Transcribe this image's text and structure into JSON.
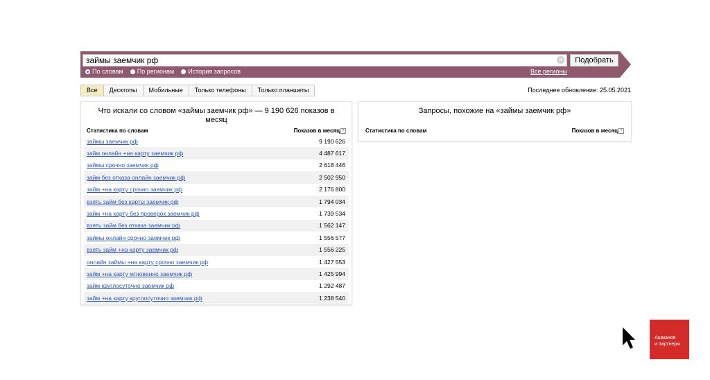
{
  "search": {
    "query": "займы заемчик рф",
    "submit_label": "Подобрать",
    "clear_icon": "clear-icon",
    "modes": [
      {
        "label": "По словам",
        "selected": true
      },
      {
        "label": "По регионам",
        "selected": false
      },
      {
        "label": "История запросов",
        "selected": false
      }
    ],
    "regions_link": "Все регионы"
  },
  "device_tabs": [
    {
      "label": "Все",
      "active": true
    },
    {
      "label": "Десктопы",
      "active": false
    },
    {
      "label": "Мобильные",
      "active": false
    },
    {
      "label": "Только телефоны",
      "active": false
    },
    {
      "label": "Только планшеты",
      "active": false
    }
  ],
  "last_update": "Последнее обновление: 25.05.2021",
  "left_panel": {
    "title": "Что искали со словом «займы заемчик рф» — 9 190 626 показов в месяц",
    "col_query": "Статистика по словам",
    "col_count": "Показов в месяц",
    "rows": [
      {
        "query": "займы заемчик рф",
        "count": "9 190 626"
      },
      {
        "query": "займ онлайн +на карту заемчик рф",
        "count": "4 487 617"
      },
      {
        "query": "займы срочно заемчик рф",
        "count": "2 618 446"
      },
      {
        "query": "займ без отказа онлайн заемчик рф",
        "count": "2 502 950"
      },
      {
        "query": "займ +на карту срочно заемчик рф",
        "count": "2 176 800"
      },
      {
        "query": "взять займ без карты заемчик рф",
        "count": "1 794 034"
      },
      {
        "query": "займ +на карту без проверок заемчик рф",
        "count": "1 739 534"
      },
      {
        "query": "взять займ без отказа заемчик рф",
        "count": "1 562 147"
      },
      {
        "query": "займы онлайн срочно заемчик рф",
        "count": "1 556 577"
      },
      {
        "query": "взять займ +на карту заемчик рф",
        "count": "1 556 225"
      },
      {
        "query": "онлайн займы +на карту срочно заемчик рф",
        "count": "1 427 553"
      },
      {
        "query": "займ +на карту мгновенно заемчик рф",
        "count": "1 425 994"
      },
      {
        "query": "займ круглосуточно заемчик рф",
        "count": "1 292 487"
      },
      {
        "query": "займ +на карту круглосуточно заемчик рф",
        "count": "1 238 540"
      }
    ]
  },
  "right_panel": {
    "title": "Запросы, похожие на «займы заемчик рф»",
    "col_query": "Статистика по словам",
    "col_count": "Показов в месяц"
  },
  "brand": {
    "line1": "Ашманов",
    "line2": "и партнеры"
  },
  "colors": {
    "band": "#8f5a6e",
    "link": "#2a55b8",
    "active_tab": "#f5edc2",
    "brand": "#d32b2a"
  }
}
